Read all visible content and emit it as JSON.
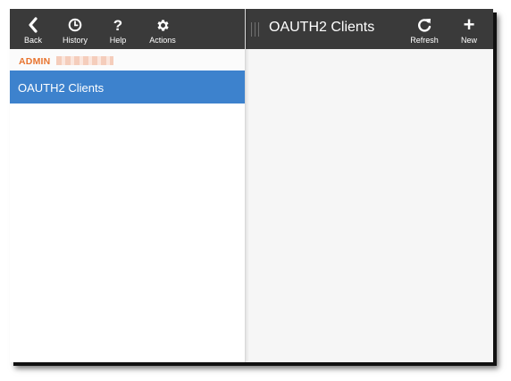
{
  "left_toolbar": {
    "back": {
      "label": "Back",
      "icon": "chevron-left-icon"
    },
    "history": {
      "label": "History",
      "icon": "clock-icon"
    },
    "help": {
      "label": "Help",
      "glyph": "?",
      "icon": "question-icon"
    },
    "actions": {
      "label": "Actions",
      "icon": "gear-icon"
    }
  },
  "section": {
    "title": "ADMIN",
    "title_color": "#e8742f"
  },
  "nav": {
    "items": [
      {
        "label": "OAUTH2 Clients",
        "selected": true
      }
    ],
    "selected_color": "#3d82cd"
  },
  "detail": {
    "title": "OAUTH2 Clients",
    "refresh": {
      "label": "Refresh",
      "icon": "refresh-icon"
    },
    "new": {
      "label": "New",
      "glyph": "+",
      "icon": "plus-icon"
    }
  },
  "colors": {
    "toolbar": "#3a3a3a",
    "accent": "#3d82cd"
  }
}
